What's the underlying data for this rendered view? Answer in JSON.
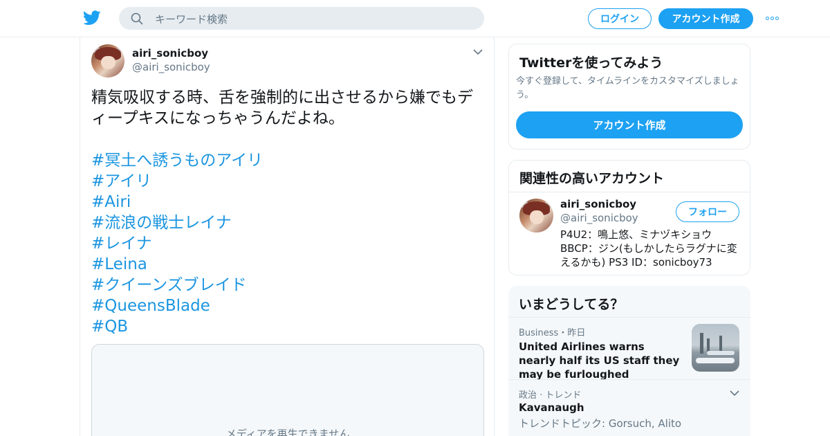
{
  "header": {
    "search_placeholder": "キーワード検索",
    "login_label": "ログイン",
    "signup_label": "アカウント作成",
    "brand_color": "#1da1f2"
  },
  "tweet": {
    "user_name": "airi_sonicboy",
    "user_handle": "@airi_sonicboy",
    "text": "精気吸収する時、舌を強制的に出させるから嫌でもディープキスになっちゃうんだよね。",
    "hashtags": [
      "#冥土へ誘うものアイリ",
      "#アイリ",
      "#Airi",
      "#流浪の戦士レイナ",
      "#レイナ",
      "#Leina",
      "#クイーンズブレイド",
      "#QueensBlade",
      "#QB"
    ],
    "media_message": "メディアを再生できません"
  },
  "signup_card": {
    "title": "Twitterを使ってみよう",
    "description": "今すぐ登録して、タイムラインをカスタマイズしましょう。",
    "button_label": "アカウント作成"
  },
  "related_card": {
    "title": "関連性の高いアカウント",
    "account": {
      "name": "airi_sonicboy",
      "handle": "@airi_sonicboy",
      "follow_label": "フォロー",
      "bio": "P4U2：鳴上悠、ミナヅキショウ BBCP：ジン(もしかしたらラグナに変えるかも) PS3 ID：sonicboy73"
    }
  },
  "trends_card": {
    "title": "いまどうしてる？",
    "items": [
      {
        "category": "Business・昨日",
        "headline": "United Airlines warns nearly half its US staff they may be furloughed"
      },
      {
        "category": "政治 · トレンド",
        "name": "Kavanaugh",
        "subtitle": "トレンドトピック: Gorsuch, Alito"
      }
    ]
  }
}
